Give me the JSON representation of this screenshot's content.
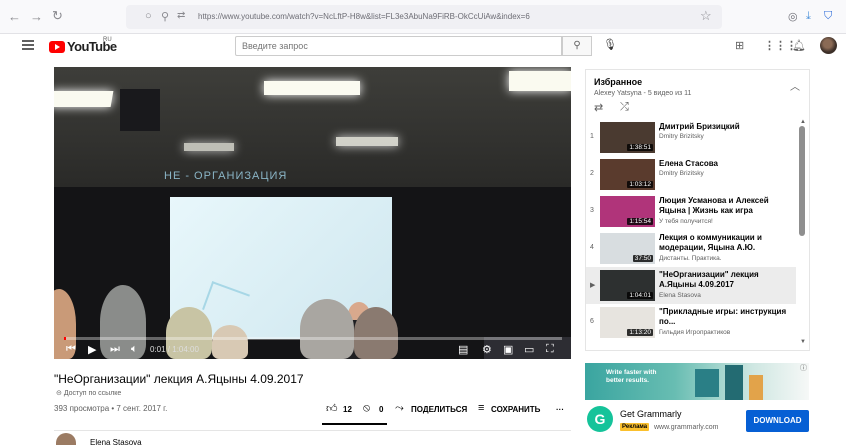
{
  "browser": {
    "url": "https://www.youtube.com/watch?v=NcLftP-H8w&list=FL3e3AbuNa9FiRB-OkCcUiAw&index=6"
  },
  "header": {
    "logo_text": "YouTube",
    "region": "RU",
    "search_placeholder": "Введите запрос"
  },
  "player": {
    "slide_title": "НЕ - ОРГАНИЗАЦИЯ",
    "time": "0:01 / 1:04:00",
    "progress": 0.0003
  },
  "video": {
    "title": "\"НеОрганизации\" лекция А.Яцыны 4.09.2017",
    "access": "Доступ по ссылке",
    "stats": "393 просмотра • 7 сент. 2017 г.",
    "likes": "12",
    "dislikes": "0",
    "share_label": "ПОДЕЛИТЬСЯ",
    "save_label": "СОХРАНИТЬ",
    "channel": "Elena Stasova"
  },
  "playlist": {
    "title": "Избранное",
    "subtitle": "Alexey Yatsyna - 5 видео из 11",
    "items": [
      {
        "index": "1",
        "title": "Дмитрий Бризицкий",
        "channel": "Dmitry Brizitsky",
        "duration": "1:38:51",
        "color": "#4a3a30"
      },
      {
        "index": "2",
        "title": "Елена Стасова",
        "channel": "Dmitry Brizitsky",
        "duration": "1:03:12",
        "color": "#5a3b2d"
      },
      {
        "index": "3",
        "title": "Люция Усманова и Алексей Яцына | Жизнь как игра",
        "channel": "У тебя получится!",
        "duration": "1:15:54",
        "color": "#b0347a"
      },
      {
        "index": "4",
        "title": "Лекция о коммуникации и модерации, Яцына А.Ю.",
        "channel": "Дистанты. Практика.",
        "duration": "37:50",
        "color": "#d8dde0"
      },
      {
        "index": "▶",
        "title": "\"НеОрганизации\" лекция А.Яцыны 4.09.2017",
        "channel": "Elena Stasova",
        "duration": "1:04:01",
        "color": "#2d3030"
      },
      {
        "index": "6",
        "title": "\"Прикладные игры: инструкция по...",
        "channel": "Гильдия Игропрактиков",
        "duration": "1:13:20",
        "color": "#e7e4df"
      }
    ]
  },
  "ad": {
    "image_text": "Write faster with better results.",
    "name": "Get Grammarly",
    "badge": "Реклама",
    "site": "www.grammarly.com",
    "button": "DOWNLOAD",
    "logo_letter": "G"
  }
}
